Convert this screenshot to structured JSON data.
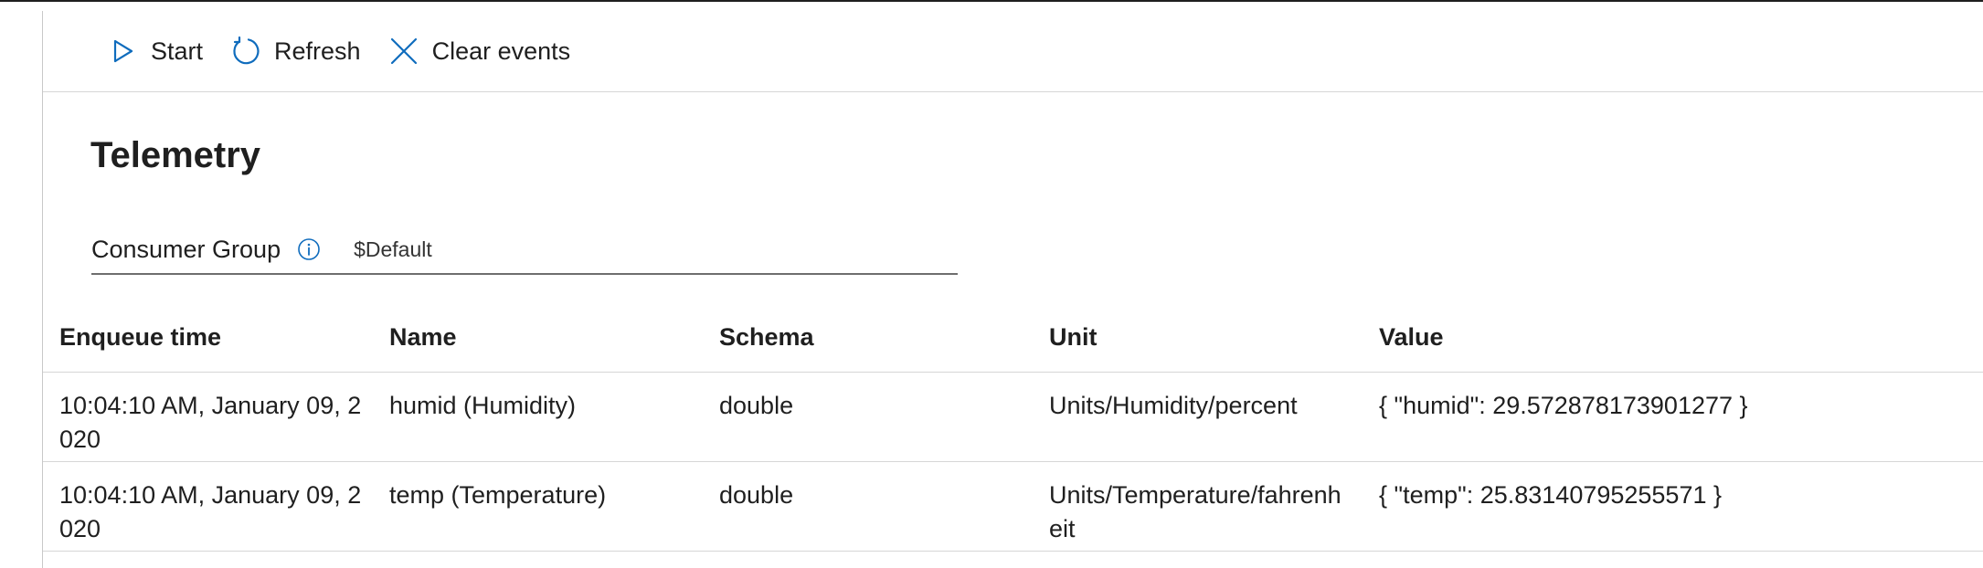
{
  "toolbar": {
    "start_label": "Start",
    "refresh_label": "Refresh",
    "clear_label": "Clear events"
  },
  "page": {
    "title": "Telemetry"
  },
  "consumer_group": {
    "label": "Consumer Group",
    "value": "$Default"
  },
  "table": {
    "headers": [
      "Enqueue time",
      "Name",
      "Schema",
      "Unit",
      "Value"
    ],
    "rows": [
      {
        "enqueue_time": "10:04:10 AM, January 09, 2020",
        "name": "humid (Humidity)",
        "schema": "double",
        "unit": "Units/Humidity/percent",
        "value": "{ \"humid\": 29.572878173901277 }"
      },
      {
        "enqueue_time": "10:04:10 AM, January 09, 2020",
        "name": "temp (Temperature)",
        "schema": "double",
        "unit": "Units/Temperature/fahrenheit",
        "value": "{ \"temp\": 25.83140795255571 }"
      }
    ]
  },
  "colors": {
    "accent": "#0f6cbd",
    "text": "#1f1f1f",
    "divider": "#d6d6d6"
  },
  "icons": {
    "start": "play-outline-icon",
    "refresh": "refresh-icon",
    "clear": "close-icon",
    "info": "info-icon"
  }
}
